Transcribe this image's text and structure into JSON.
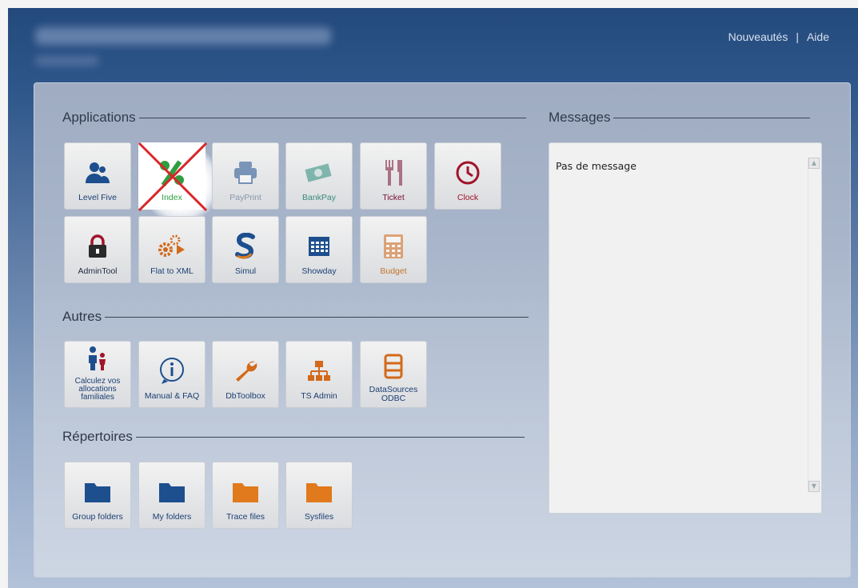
{
  "header": {
    "links": [
      "Nouveautés",
      "Aide"
    ],
    "separator": "|"
  },
  "sections": {
    "applications": {
      "title": "Applications",
      "tiles": [
        {
          "label": "Level Five",
          "icon": "users-icon"
        },
        {
          "label": "Index",
          "icon": "percent-icon",
          "crossed": true
        },
        {
          "label": "PayPrint",
          "icon": "printer-icon"
        },
        {
          "label": "BankPay",
          "icon": "banknote-icon"
        },
        {
          "label": "Ticket",
          "icon": "fork-knife-icon"
        },
        {
          "label": "Clock",
          "icon": "clock-icon"
        },
        {
          "label": "AdminTool",
          "icon": "lock-icon"
        },
        {
          "label": "Flat to XML",
          "icon": "gear-arrow-icon"
        },
        {
          "label": "Simul",
          "icon": "s-letter-icon"
        },
        {
          "label": "Showday",
          "icon": "calendar-icon"
        },
        {
          "label": "Budget",
          "icon": "calculator-icon"
        }
      ]
    },
    "autres": {
      "title": "Autres",
      "tiles": [
        {
          "label": "Calculez vos allocations familiales",
          "icon": "family-icon"
        },
        {
          "label": "Manual & FAQ",
          "icon": "info-icon"
        },
        {
          "label": "DbToolbox",
          "icon": "wrench-icon"
        },
        {
          "label": "TS Admin",
          "icon": "network-icon"
        },
        {
          "label": "DataSources ODBC",
          "icon": "database-icon"
        }
      ]
    },
    "repertoires": {
      "title": "Répertoires",
      "tiles": [
        {
          "label": "Group folders",
          "icon": "folder-icon"
        },
        {
          "label": "My folders",
          "icon": "folder-icon"
        },
        {
          "label": "Trace files",
          "icon": "folder-icon"
        },
        {
          "label": "Sysfiles",
          "icon": "folder-icon"
        }
      ]
    }
  },
  "messages": {
    "title": "Messages",
    "text": "Pas de message"
  },
  "colors": {
    "header": "#244a7c",
    "tile_label": "#1b3f73",
    "cross": "#d9262a",
    "percent": "#2f9e3f",
    "folder_blue": "#1d4f8e",
    "folder_orange": "#e07a1c"
  }
}
